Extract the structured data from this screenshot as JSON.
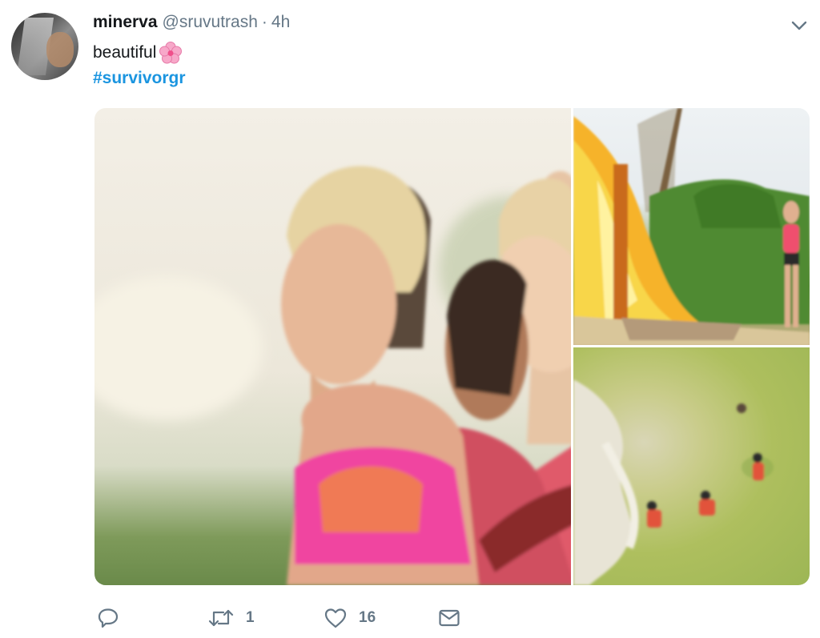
{
  "tweet": {
    "display_name": "minerva",
    "handle": "@sruvutrash",
    "separator": "·",
    "time": "4h",
    "text": "beautiful",
    "emoji": "cherry-blossom-emoji",
    "hashtag": "#survivorgr"
  },
  "media": {
    "images": [
      {
        "name": "photo-three-contestants"
      },
      {
        "name": "photo-burning-torch"
      },
      {
        "name": "photo-aerial-field"
      }
    ]
  },
  "actions": {
    "reply_count": "",
    "retweet_count": "1",
    "like_count": "16"
  },
  "colors": {
    "link": "#1b95e0",
    "secondary_text": "#657786",
    "primary_text": "#14171a"
  },
  "icons": [
    "chevron-down-icon",
    "reply-icon",
    "retweet-icon",
    "like-icon",
    "direct-message-icon"
  ]
}
